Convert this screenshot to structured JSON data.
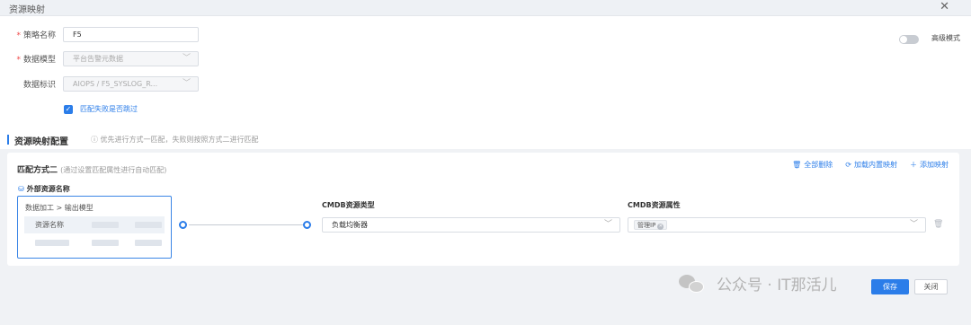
{
  "dialog": {
    "title": "资源映射"
  },
  "form": {
    "strategy_name": {
      "label": "策略名称",
      "value": "F5"
    },
    "data_model": {
      "label": "数据模型",
      "value": "平台告警元数据"
    },
    "data_identifier": {
      "label": "数据标识",
      "value": "AIOPS / F5_SYSLOG_R..."
    },
    "skip_on_fail": {
      "label": "匹配失败是否跳过",
      "checked": true
    },
    "advanced_mode": {
      "label": "高级模式",
      "enabled": false
    }
  },
  "section": {
    "title": "资源映射配置",
    "info": "ⓘ 优先进行方式一匹配，失败则按照方式二进行匹配"
  },
  "match_card": {
    "title": "匹配方式二",
    "subtitle": "(通过设置匹配属性进行自动匹配)",
    "actions": {
      "delete_all": "全部删除",
      "load_builtin": "加载内置映射",
      "add_mapping": "添加映射"
    },
    "external_label": "外部资源名称",
    "source_path": "数据加工 > 输出模型",
    "source_field": "资源名称",
    "cmdb_type": {
      "label": "CMDB资源类型",
      "value": "负载均衡器"
    },
    "cmdb_attr": {
      "label": "CMDB资源属性",
      "tag": "管理IP"
    }
  },
  "footer": {
    "save_label": "保存",
    "close_label": "关闭"
  },
  "watermark": {
    "text": "公众号 · IT那活儿"
  },
  "colors": {
    "accent": "#2b7de9",
    "required": "#f04848"
  }
}
